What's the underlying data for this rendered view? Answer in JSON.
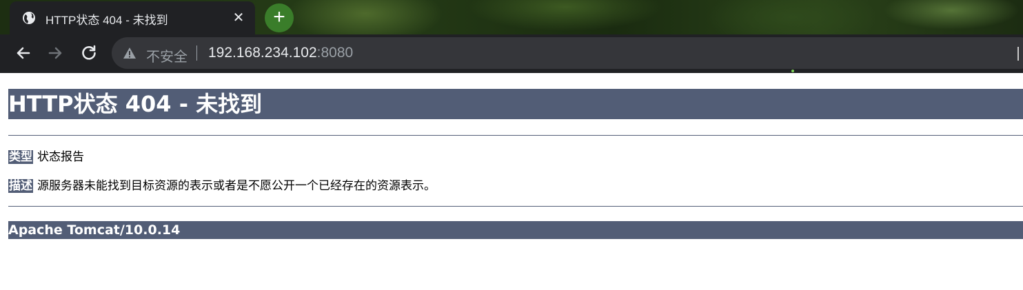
{
  "browser": {
    "tab": {
      "title": "HTTP状态 404 - 未找到",
      "close_glyph": "✕",
      "favicon": "globe-icon"
    },
    "new_tab_glyph": "+",
    "nav": {
      "back_icon": "arrow-left-icon",
      "forward_icon": "arrow-right-icon",
      "reload_icon": "reload-icon"
    },
    "omnibox": {
      "security_label": "不安全",
      "url_host": "192.168.234.102",
      "url_port": ":8080"
    },
    "colors": {
      "frame_dark": "#202124",
      "omnibox_bg": "#35363a",
      "new_tab_green": "#3a7d2a"
    }
  },
  "page": {
    "heading": "HTTP状态 404 - 未找到",
    "type_label": "类型",
    "type_value": "状态报告",
    "description_label": "描述",
    "description_value": "源服务器未能找到目标资源的表示或者是不愿公开一个已经存在的资源表示。",
    "footer": "Apache Tomcat/10.0.14",
    "colors": {
      "accent": "#525d76"
    }
  }
}
